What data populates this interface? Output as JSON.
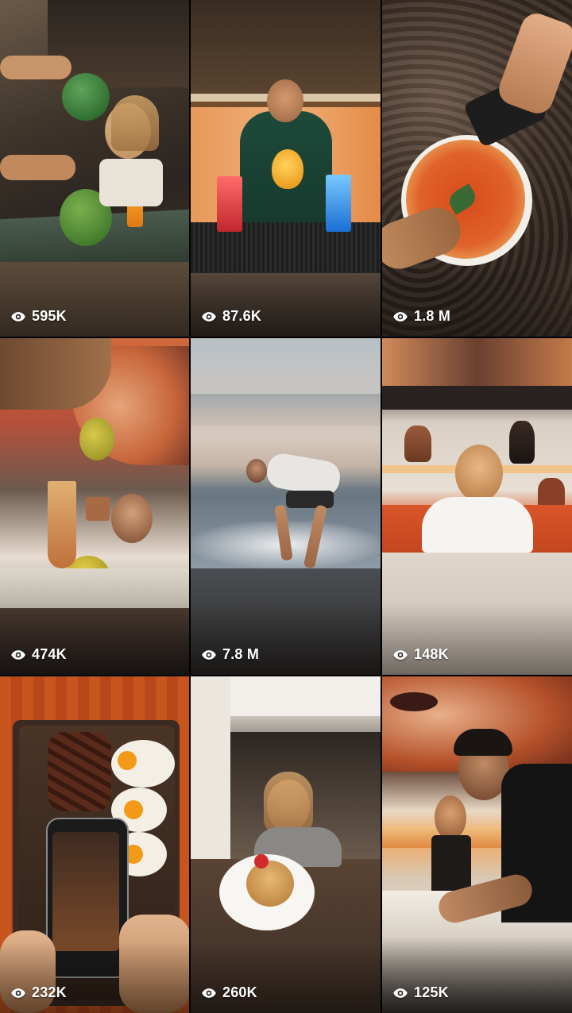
{
  "grid": {
    "tiles": [
      {
        "views": "595K",
        "theme": "watermelon-cafe"
      },
      {
        "views": "87.6K",
        "theme": "bartender-cocktails"
      },
      {
        "views": "1.8 M",
        "theme": "pizza-phone"
      },
      {
        "views": "474K",
        "theme": "durian-mural"
      },
      {
        "views": "7.8 M",
        "theme": "beach-waves"
      },
      {
        "views": "148K",
        "theme": "woman-vases"
      },
      {
        "views": "232K",
        "theme": "steak-platter-phone"
      },
      {
        "views": "260K",
        "theme": "pancakes-restaurant"
      },
      {
        "views": "125K",
        "theme": "man-selfie-mural"
      }
    ]
  },
  "icons": {
    "views_icon": "eye-icon"
  },
  "colors": {
    "background": "#000000",
    "overlay_text": "#ffffff"
  }
}
